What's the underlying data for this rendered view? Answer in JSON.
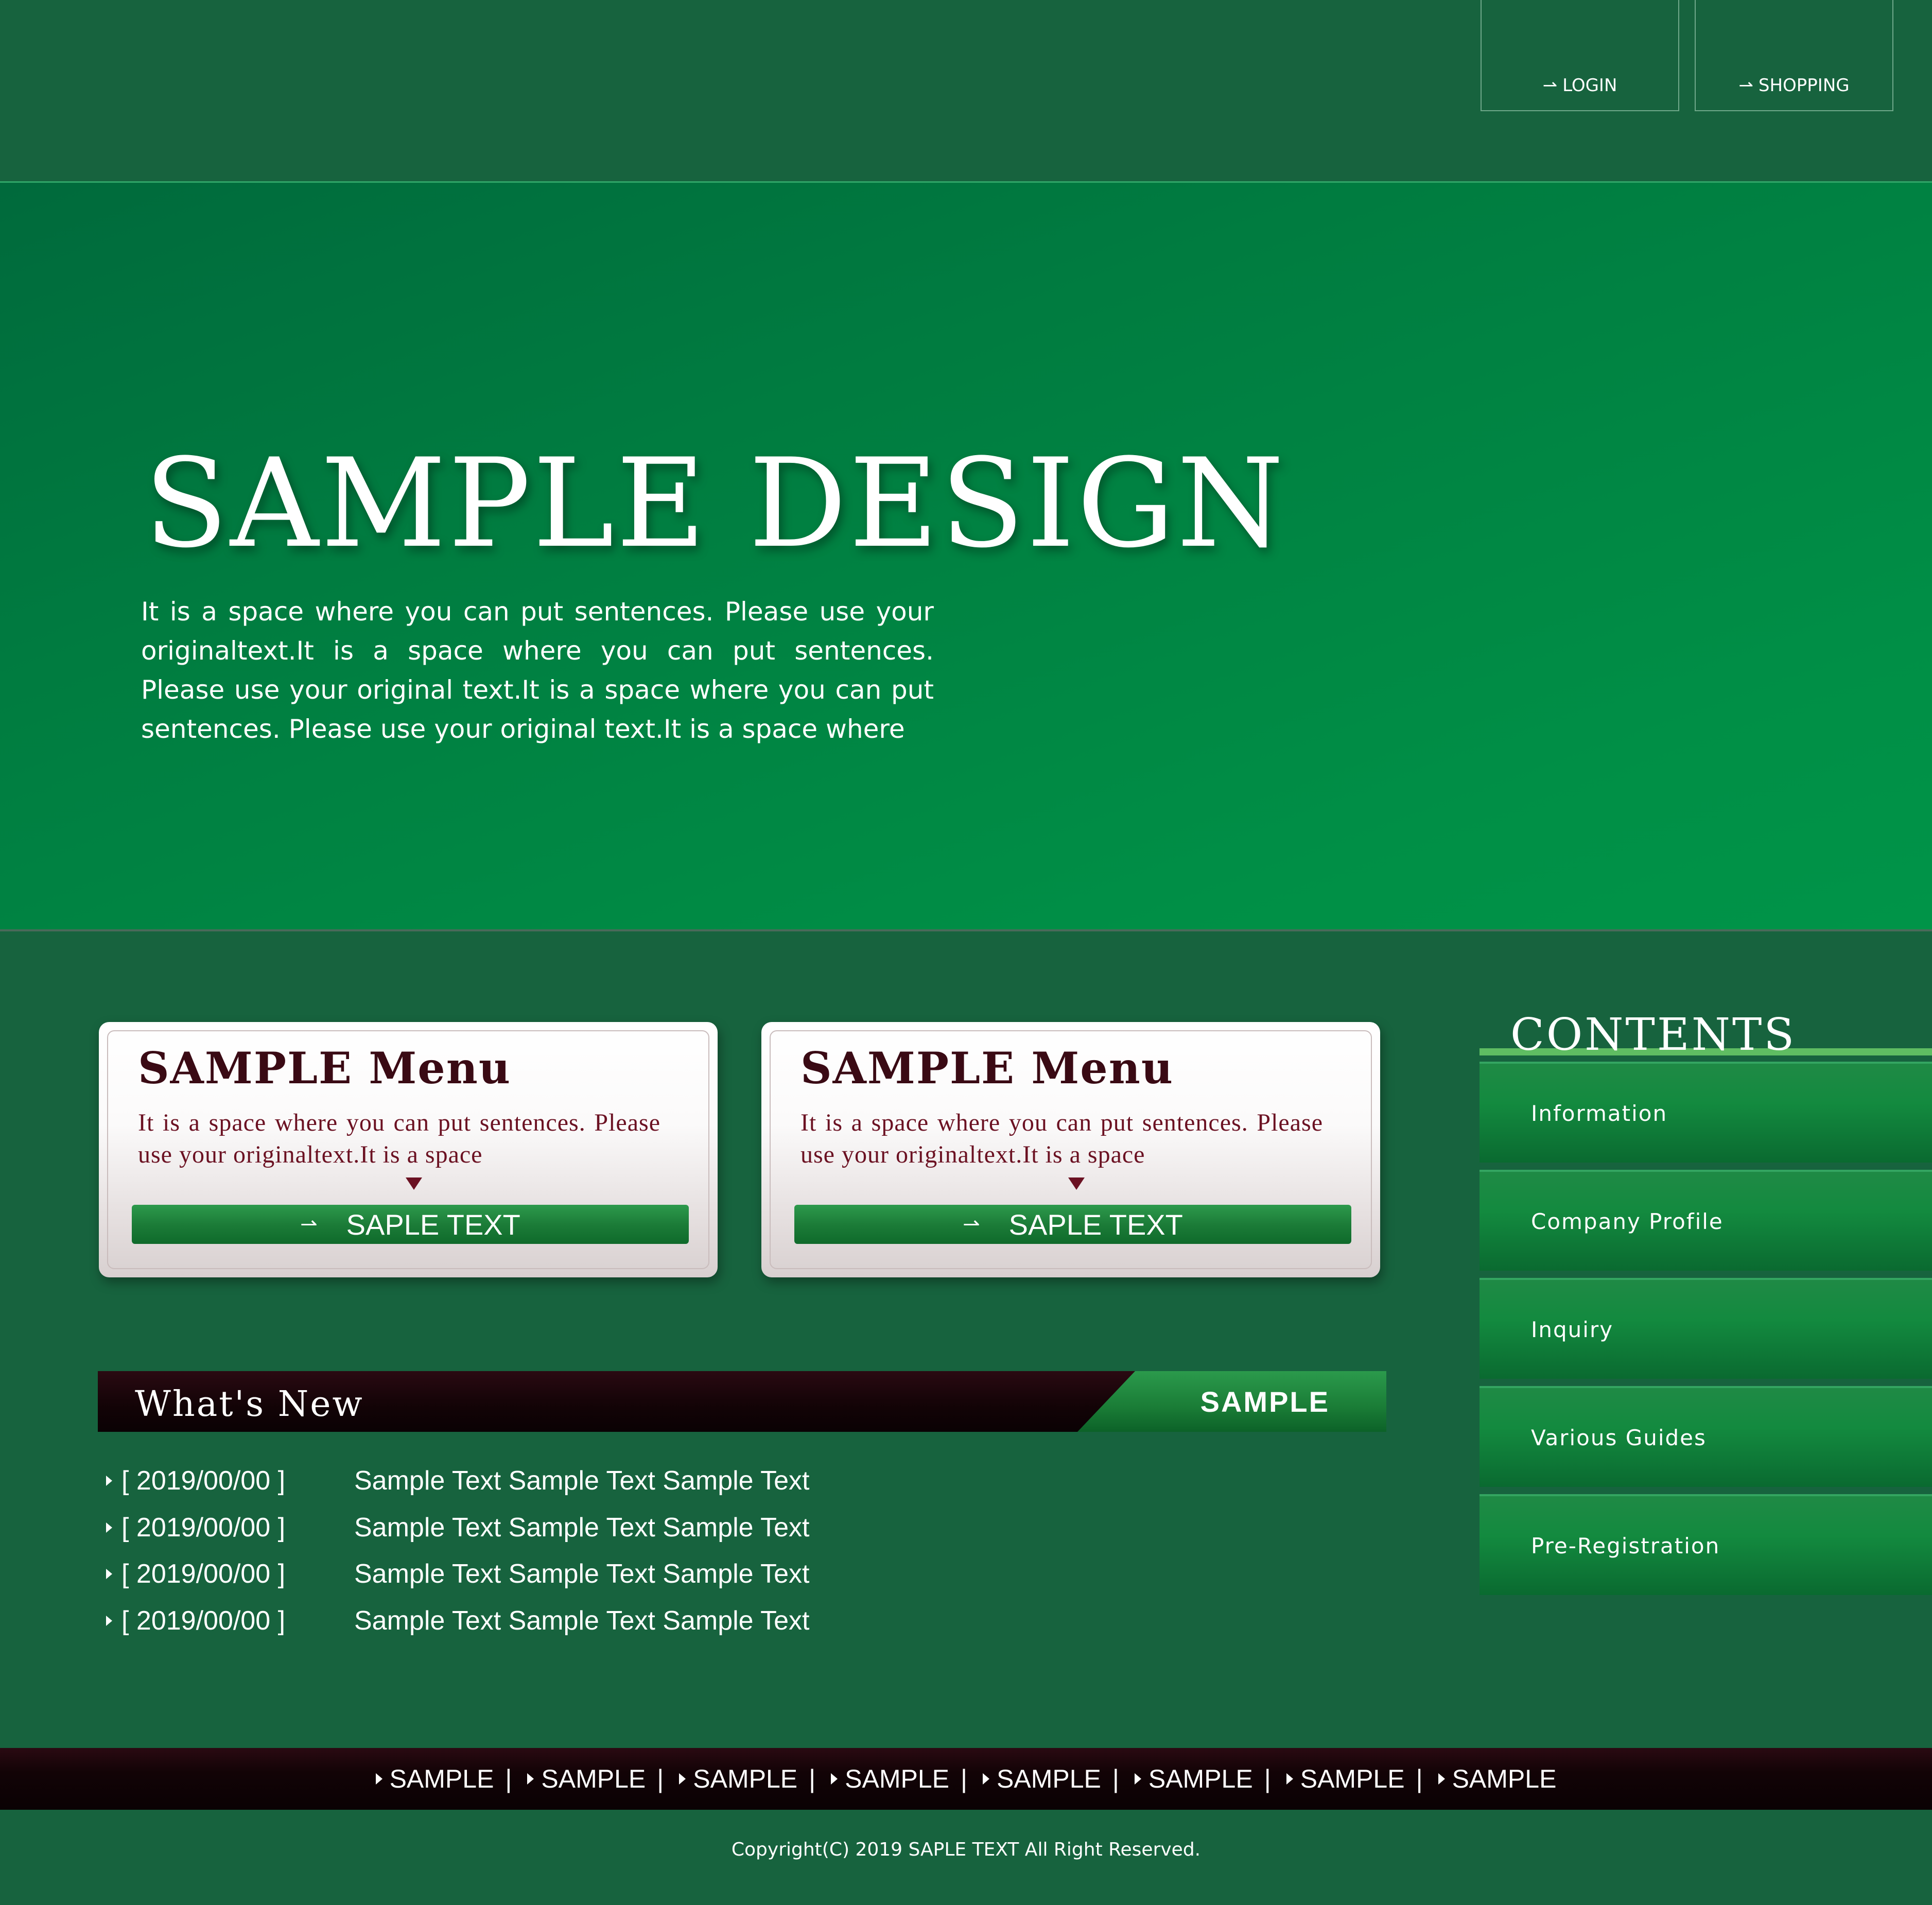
{
  "header": {
    "login_label": "LOGIN",
    "shopping_label": "SHOPPING"
  },
  "hero": {
    "title": "SAMPLE DESIGN",
    "text": "It is a space where you can put sentences. Please use your originaltext.It is a space where you can put sentences. Please use your original text.It is a space where you can put sentences. Please use your original text.It is a space where"
  },
  "menus": [
    {
      "title": "SAMPLE Menu",
      "text": "It is a space where you can put sentences. Please use your originaltext.It is a space",
      "button": "SAPLE TEXT"
    },
    {
      "title": "SAMPLE Menu",
      "text": "It is a space where you can put sentences. Please use your originaltext.It is a space",
      "button": "SAPLE TEXT"
    }
  ],
  "whats_new": {
    "title": "What's New",
    "tab": "SAMPLE",
    "items": [
      {
        "date": "[ 2019/00/00 ]",
        "text": "Sample Text Sample Text Sample Text"
      },
      {
        "date": "[ 2019/00/00 ]",
        "text": "Sample Text Sample Text Sample Text"
      },
      {
        "date": "[ 2019/00/00 ]",
        "text": "Sample Text Sample Text Sample Text"
      },
      {
        "date": "[ 2019/00/00 ]",
        "text": "Sample Text Sample Text Sample Text"
      }
    ]
  },
  "contents": {
    "title": "CONTENTS",
    "items": [
      "Information",
      "Company Profile",
      "Inquiry",
      "Various Guides",
      "Pre-Registration"
    ]
  },
  "footer": {
    "links": [
      "SAMPLE",
      "SAMPLE",
      "SAMPLE",
      "SAMPLE",
      "SAMPLE",
      "SAMPLE",
      "SAMPLE",
      "SAMPLE"
    ],
    "separator": "|",
    "copyright": "Copyright(C) 2019 SAPLE TEXT All Right Reserved."
  },
  "colors": {
    "background": "#17633e",
    "hero_green": "#008f46",
    "accent_maroon": "#3a0a14",
    "button_green": "#1c7c38"
  },
  "icons": {
    "arrow": "right-arrow-icon",
    "bullet": "triangle-right-icon"
  }
}
